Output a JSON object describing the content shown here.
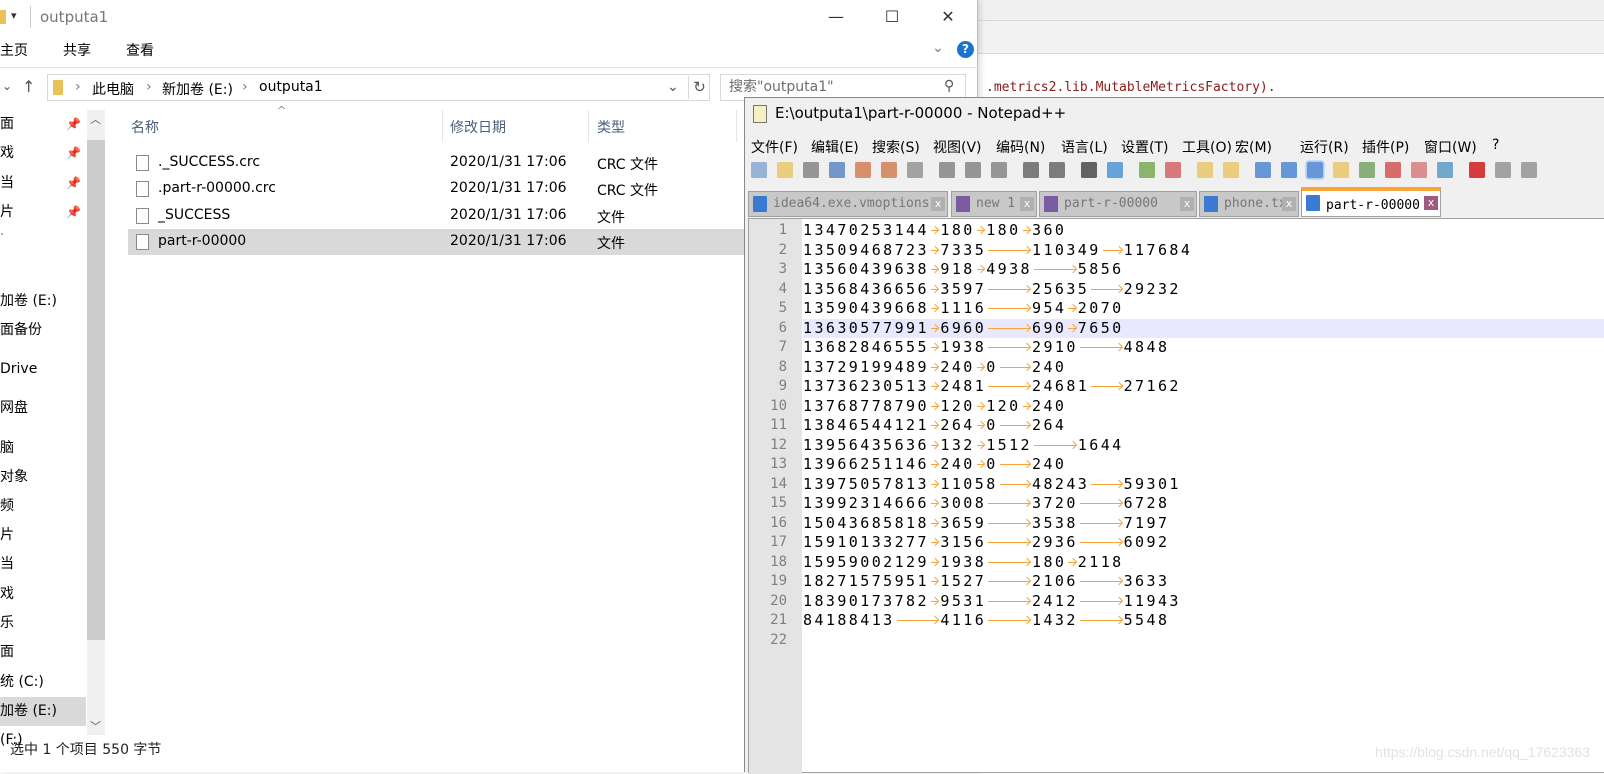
{
  "background_ide": {
    "code_text": ".metrics2.lib.MutableMetricsFactory)."
  },
  "explorer": {
    "title": "outputa1",
    "window_buttons": {
      "minimize": "—",
      "maximize": "☐",
      "close": "✕"
    },
    "ribbon_tabs": [
      "主页",
      "共享",
      "查看"
    ],
    "help": "?",
    "breadcrumb": [
      "此电脑",
      "新加卷 (E:)",
      "outputa1"
    ],
    "search_placeholder": "搜索\"outputa1\"",
    "nav_items": [
      {
        "label": "面",
        "pinned": true
      },
      {
        "label": "戏",
        "pinned": true
      },
      {
        "label": "当",
        "pinned": true
      },
      {
        "label": "片",
        "pinned": true
      },
      {
        "label": "加卷 (E:)"
      },
      {
        "label": "面备份"
      },
      {
        "label": "Drive"
      },
      {
        "label": "网盘"
      },
      {
        "label": "脑"
      },
      {
        "label": "对象"
      },
      {
        "label": "频"
      },
      {
        "label": "片"
      },
      {
        "label": "当"
      },
      {
        "label": "戏"
      },
      {
        "label": "乐"
      },
      {
        "label": "面"
      },
      {
        "label": "统 (C:)"
      },
      {
        "label": "加卷 (E:)",
        "selected": true
      },
      {
        "label": "(F:)"
      }
    ],
    "columns": [
      "名称",
      "修改日期",
      "类型"
    ],
    "files": [
      {
        "name": "._SUCCESS.crc",
        "date": "2020/1/31 17:06",
        "type": "CRC 文件"
      },
      {
        "name": ".part-r-00000.crc",
        "date": "2020/1/31 17:06",
        "type": "CRC 文件"
      },
      {
        "name": "_SUCCESS",
        "date": "2020/1/31 17:06",
        "type": "文件"
      },
      {
        "name": "part-r-00000",
        "date": "2020/1/31 17:06",
        "type": "文件",
        "selected": true
      }
    ],
    "status": "选中 1 个项目  550 字节"
  },
  "notepad": {
    "title": "E:\\outputa1\\part-r-00000 - Notepad++",
    "menu": [
      "文件(F)",
      "编辑(E)",
      "搜索(S)",
      "视图(V)",
      "编码(N)",
      "语言(L)",
      "设置(T)",
      "工具(O)",
      "宏(M)",
      "运行(R)",
      "插件(P)",
      "窗口(W)",
      "?"
    ],
    "tabs": [
      {
        "label": "idea64.exe.vmoptions",
        "icon_color": "#3a7ad0"
      },
      {
        "label": "new 1",
        "icon_color": "#7a5aa0"
      },
      {
        "label": "part-r-00000",
        "icon_color": "#7a5aa0"
      },
      {
        "label": "phone.txt",
        "icon_color": "#3a7ad0"
      },
      {
        "label": "part-r-00000",
        "icon_color": "#3a7ad0",
        "active": true
      }
    ],
    "current_line": 6,
    "accent": "#faa43a",
    "lines": [
      [
        "13470253144",
        "180",
        "180",
        "360"
      ],
      [
        "13509468723",
        "7335",
        "110349",
        "117684"
      ],
      [
        "13560439638",
        "918",
        "4938",
        "5856"
      ],
      [
        "13568436656",
        "3597",
        "25635",
        "29232"
      ],
      [
        "13590439668",
        "1116",
        "954",
        "2070"
      ],
      [
        "13630577991",
        "6960",
        "690",
        "7650"
      ],
      [
        "13682846555",
        "1938",
        "2910",
        "4848"
      ],
      [
        "13729199489",
        "240",
        "0",
        "240"
      ],
      [
        "13736230513",
        "2481",
        "24681",
        "27162"
      ],
      [
        "13768778790",
        "120",
        "120",
        "240"
      ],
      [
        "13846544121",
        "264",
        "0",
        "264"
      ],
      [
        "13956435636",
        "132",
        "1512",
        "1644"
      ],
      [
        "13966251146",
        "240",
        "0",
        "240"
      ],
      [
        "13975057813",
        "11058",
        "48243",
        "59301"
      ],
      [
        "13992314666",
        "3008",
        "3720",
        "6728"
      ],
      [
        "15043685818",
        "3659",
        "3538",
        "7197"
      ],
      [
        "15910133277",
        "3156",
        "2936",
        "6092"
      ],
      [
        "15959002129",
        "1938",
        "180",
        "2118"
      ],
      [
        "18271575951",
        "1527",
        "2106",
        "3633"
      ],
      [
        "18390173782",
        "9531",
        "2412",
        "11943"
      ],
      [
        "84188413",
        "4116",
        "1432",
        "5548"
      ],
      []
    ]
  },
  "watermark": "https://blog.csdn.net/qq_17623363"
}
